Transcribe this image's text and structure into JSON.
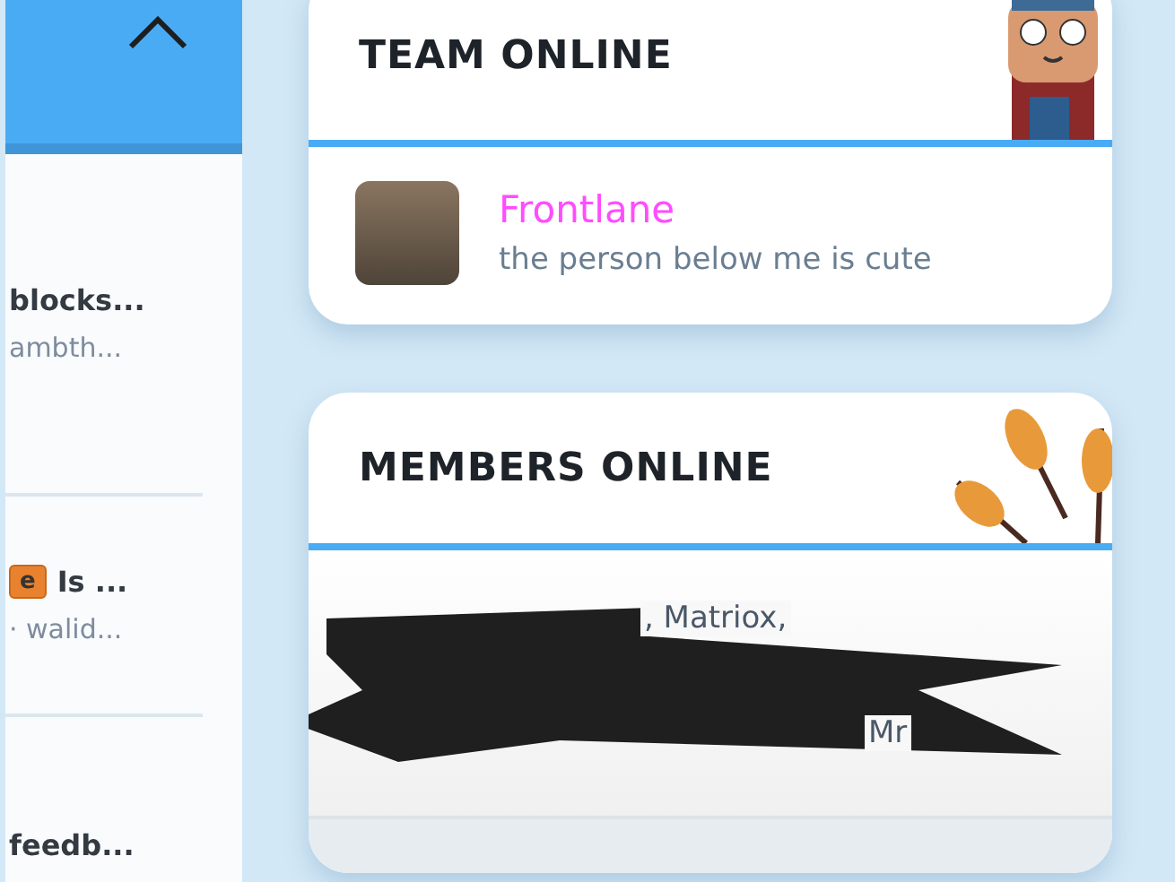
{
  "sidebar": {
    "items": [
      {
        "title": "blocks...",
        "subtitle": "ambth..."
      },
      {
        "badge": "e",
        "title": "Is ...",
        "subtitle": "· walid..."
      },
      {
        "title": "feedb..."
      }
    ]
  },
  "team_online": {
    "title": "TEAM ONLINE",
    "members": [
      {
        "name": "Frontlane",
        "status": "the person below me is cute",
        "color": "#ff4cff"
      }
    ]
  },
  "members_online": {
    "title": "MEMBERS ONLINE",
    "visible_fragments": [
      ", Matriox,",
      "Mr"
    ]
  }
}
